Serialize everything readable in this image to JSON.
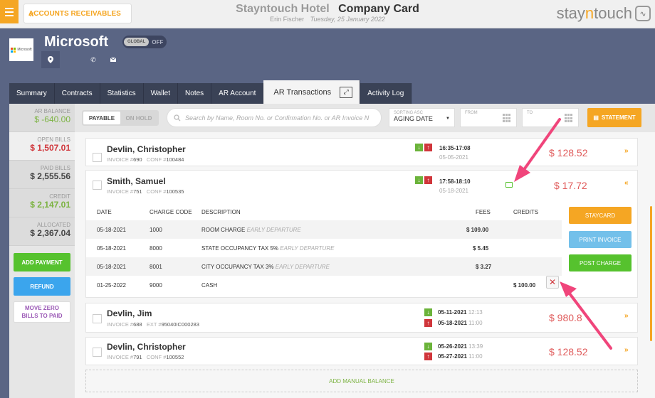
{
  "header": {
    "menu_icon": "hamburger-icon",
    "back_label": "ACCOUNTS RECEIVABLES",
    "hotel_name": "Stayntouch Hotel",
    "page_title": "Company Card",
    "user": "Erin Fischer",
    "date": "Tuesday, 25 January 2022",
    "logo_prefix": "stay",
    "logo_accent": "n",
    "logo_suffix": "touch"
  },
  "company": {
    "name": "Microsoft",
    "logo_text": "Microsoft",
    "global_label": "GLOBAL",
    "toggle_state": "OFF"
  },
  "tabs": [
    {
      "label": "Summary"
    },
    {
      "label": "Contracts"
    },
    {
      "label": "Statistics"
    },
    {
      "label": "Wallet"
    },
    {
      "label": "Notes"
    },
    {
      "label": "AR Account"
    },
    {
      "label": "AR Transactions",
      "active": true
    },
    {
      "label": "Activity Log"
    }
  ],
  "balances": {
    "ar_balance": {
      "label": "AR BALANCE",
      "value": "$ -640.00"
    },
    "open_bills": {
      "label": "OPEN BILLS",
      "value": "$ 1,507.01"
    },
    "paid_bills": {
      "label": "PAID BILLS",
      "value": "$ 2,555.56"
    },
    "credit": {
      "label": "CREDIT",
      "value": "$ 2,147.01"
    },
    "allocated": {
      "label": "ALLOCATED",
      "value": "$ 2,367.04"
    }
  },
  "side_buttons": {
    "add_payment": "ADD PAYMENT",
    "refund": "REFUND",
    "move_zero_1": "MOVE ZERO",
    "move_zero_2": "BILLS TO PAID"
  },
  "filters": {
    "payable": "PAYABLE",
    "on_hold": "ON HOLD",
    "search_placeholder": "Search by Name, Room No. or Confirmation No. or AR Invoice N",
    "sort_label": "SORTING ASC",
    "sort_value": "AGING DATE",
    "from_label": "FROM",
    "to_label": "TO",
    "statement": "STATEMENT"
  },
  "invoices": [
    {
      "name": "Devlin, Christopher",
      "invoice_label": "INVOICE #",
      "invoice": "690",
      "ref_label": "CONF #",
      "ref": "100484",
      "t1": "16:35-17:08",
      "t2": "05-05-2021",
      "amount": "$ 128.52"
    },
    {
      "name": "Smith, Samuel",
      "invoice_label": "INVOICE #",
      "invoice": "751",
      "ref_label": "CONF #",
      "ref": "100535",
      "t1": "17:58-18:10",
      "t2": "05-18-2021",
      "amount": "$ 17.72"
    },
    {
      "name": "Devlin, Jim",
      "invoice_label": "INVOICE #",
      "invoice": "688",
      "ref_label": "EXT #",
      "ref": "95040IC000283",
      "d1": "05-11-2021",
      "d1t": "12:13",
      "d2": "05-18-2021",
      "d2t": "11:00",
      "amount": "$ 980.8"
    },
    {
      "name": "Devlin, Christopher",
      "invoice_label": "INVOICE #",
      "invoice": "791",
      "ref_label": "CONF #",
      "ref": "100552",
      "d1": "05-26-2021",
      "d1t": "13:39",
      "d2": "05-27-2021",
      "d2t": "11:00",
      "amount": "$ 128.52"
    }
  ],
  "detail": {
    "headers": {
      "date": "DATE",
      "charge_code": "CHARGE CODE",
      "description": "DESCRIPTION",
      "fees": "FEES",
      "credits": "CREDITS"
    },
    "rows": [
      {
        "date": "05-18-2021",
        "code": "1000",
        "desc": "ROOM CHARGE",
        "note": "EARLY DEPARTURE",
        "fee": "$ 109.00",
        "credit": ""
      },
      {
        "date": "05-18-2021",
        "code": "8000",
        "desc": "STATE OCCUPANCY TAX 5%",
        "note": "EARLY DEPARTURE",
        "fee": "$ 5.45",
        "credit": ""
      },
      {
        "date": "05-18-2021",
        "code": "8001",
        "desc": "CITY OCCUPANCY TAX 3%",
        "note": "EARLY DEPARTURE",
        "fee": "$ 3.27",
        "credit": ""
      },
      {
        "date": "01-25-2022",
        "code": "9000",
        "desc": "CASH",
        "note": "",
        "fee": "",
        "credit": "$ 100.00"
      }
    ],
    "buttons": {
      "staycard": "STAYCARD",
      "print": "PRINT INVOICE",
      "post": "POST CHARGE"
    }
  },
  "add_manual_balance": "ADD MANUAL BALANCE",
  "colors": {
    "accent": "#f5a623",
    "green": "#56c22e",
    "red": "#d0363b",
    "blue": "#3ba5ed",
    "annotation": "#f0457b"
  }
}
